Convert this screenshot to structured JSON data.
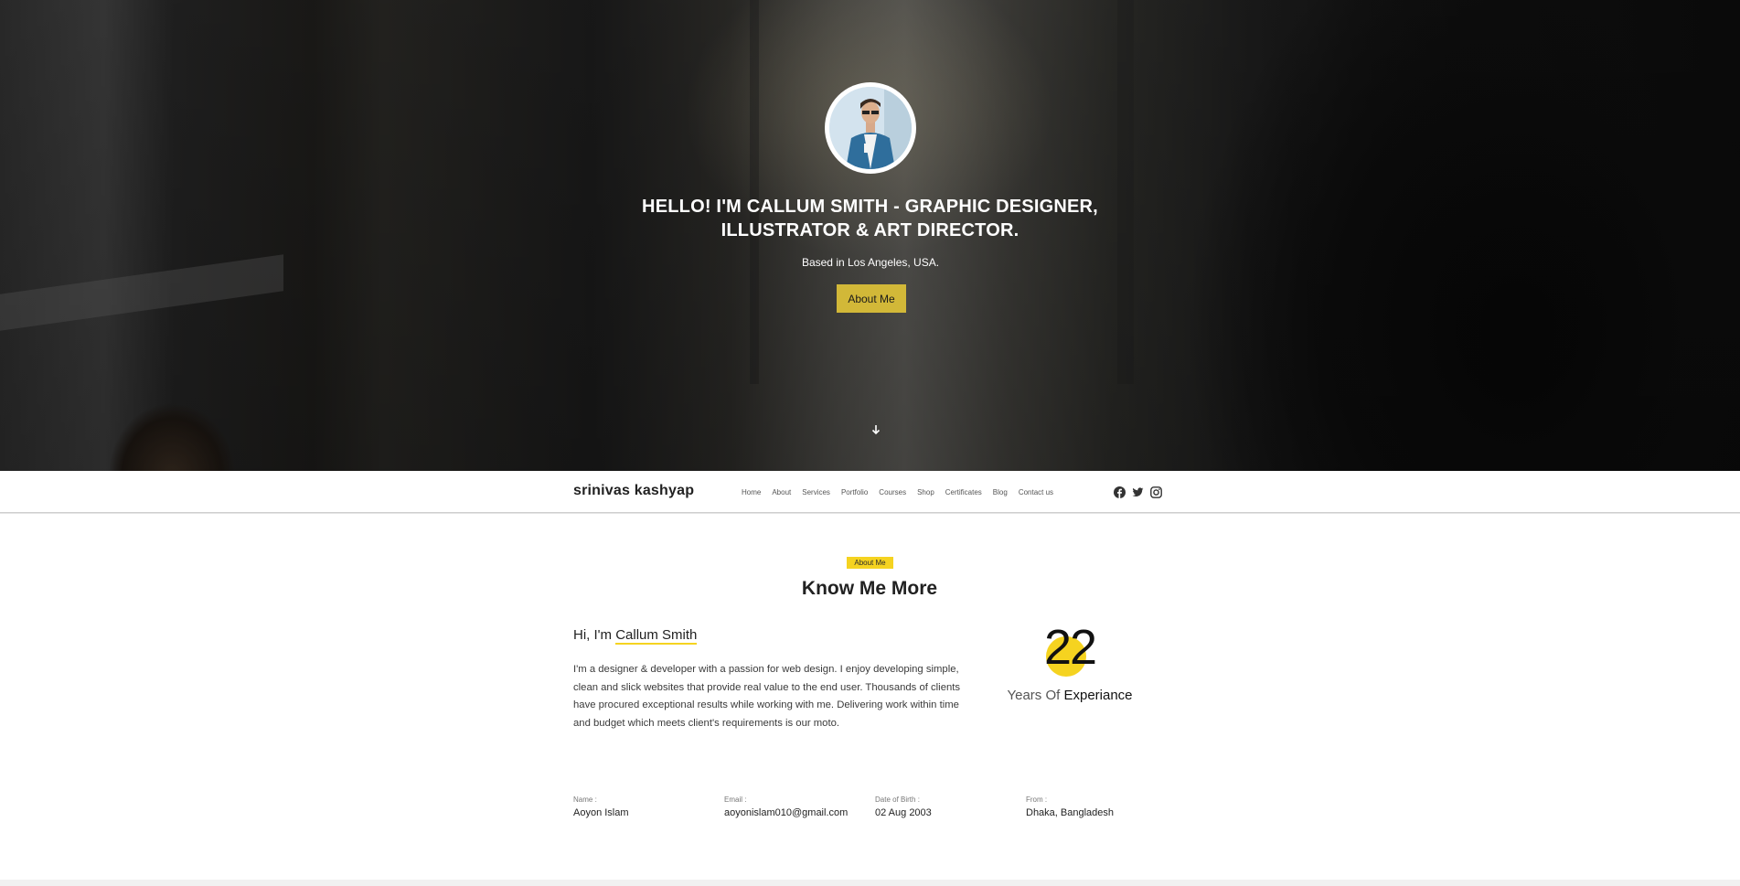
{
  "hero": {
    "title": "HELLO! I'M CALLUM SMITH - GRAPHIC DESIGNER, ILLUSTRATOR & ART DIRECTOR.",
    "subtitle": "Based in Los Angeles, USA.",
    "cta_label": "About Me",
    "scroll_icon": "arrow-down-icon"
  },
  "navbar": {
    "brand": "srinivas kashyap",
    "links": [
      "Home",
      "About",
      "Services",
      "Portfolio",
      "Courses",
      "Shop",
      "Certificates",
      "Blog",
      "Contact us"
    ],
    "socials": [
      "facebook-icon",
      "twitter-icon",
      "instagram-icon"
    ]
  },
  "about": {
    "tag": "About Me",
    "title": "Know Me More",
    "greeting_prefix": "Hi, I'm ",
    "greeting_name": "Callum Smith",
    "bio": "I'm a designer & developer with a passion for web design. I enjoy developing simple, clean and slick websites that provide real value to the end user. Thousands of clients have procured exceptional results while working with me. Delivering work within time and budget which meets client's requirements is our moto.",
    "years_value": "22",
    "years_label_prefix": "Years Of ",
    "years_label_strong": "Experiance",
    "facts": [
      {
        "label": "Name :",
        "value": "Aoyon Islam"
      },
      {
        "label": "Email :",
        "value": "aoyonislam010@gmail.com"
      },
      {
        "label": "Date of Birth :",
        "value": "02 Aug 2003"
      },
      {
        "label": "From :",
        "value": "Dhaka, Bangladesh"
      }
    ]
  },
  "colors": {
    "accent": "#f5d320",
    "button": "#d2b838",
    "text": "#212121"
  }
}
